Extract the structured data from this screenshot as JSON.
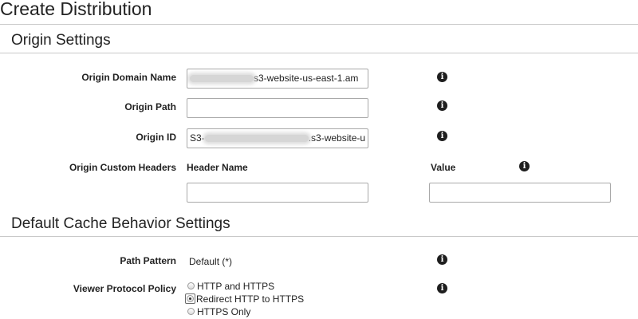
{
  "page": {
    "title": "Create Distribution"
  },
  "origin_settings": {
    "title": "Origin Settings",
    "origin_domain_name": {
      "label": "Origin Domain Name",
      "value": "s3-website-us-east-1.am"
    },
    "origin_path": {
      "label": "Origin Path",
      "value": ""
    },
    "origin_id": {
      "label": "Origin ID",
      "prefix": "S3-",
      "suffix": ".s3-website-u"
    },
    "custom_headers": {
      "label": "Origin Custom Headers",
      "header_name_label": "Header Name",
      "value_label": "Value",
      "header_name_value": "",
      "value_value": ""
    }
  },
  "cache_behavior": {
    "title": "Default Cache Behavior Settings",
    "path_pattern": {
      "label": "Path Pattern",
      "value": "Default (*)"
    },
    "viewer_protocol_policy": {
      "label": "Viewer Protocol Policy",
      "options": [
        "HTTP and HTTPS",
        "Redirect HTTP to HTTPS",
        "HTTPS Only"
      ],
      "selected": "Redirect HTTP to HTTPS"
    }
  },
  "icons": {
    "info": "info-icon"
  },
  "colors": {
    "rule": "#c9c9c9",
    "info_icon": "#1e1e1e"
  }
}
